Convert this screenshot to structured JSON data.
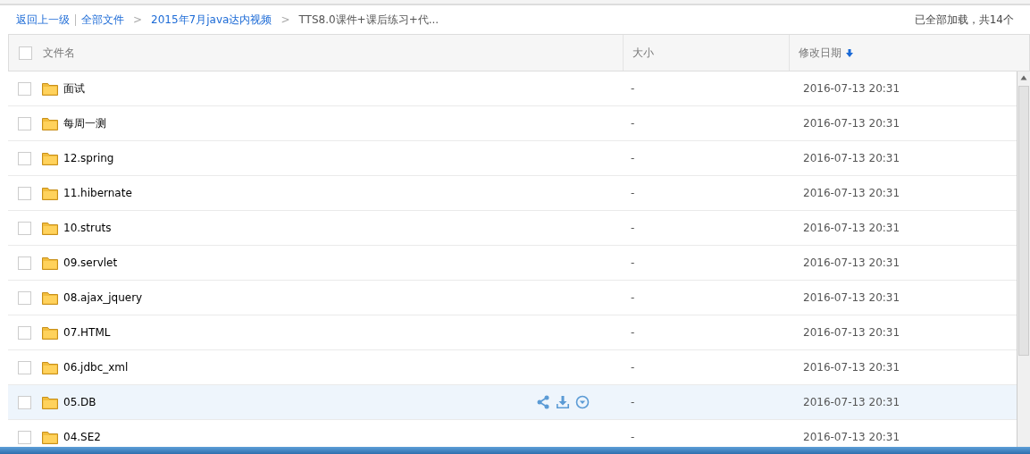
{
  "breadcrumb": {
    "back": "返回上一级",
    "items": [
      {
        "label": "全部文件",
        "link": true
      },
      {
        "label": "2015年7月java达内视频",
        "link": true,
        "separator": ">"
      },
      {
        "label": "TTS8.0课件+课后练习+代...",
        "link": false,
        "separator": ">"
      }
    ],
    "status": "已全部加载，共14个"
  },
  "table": {
    "select_all_checked": false,
    "columns": [
      {
        "label": "文件名"
      },
      {
        "label": "大小"
      },
      {
        "label": "修改日期",
        "sorted": true
      }
    ],
    "rows": [
      {
        "name": "面试",
        "size": "-",
        "date": "2016-07-13 20:31",
        "checked": false,
        "hovered": false
      },
      {
        "name": "每周一测",
        "size": "-",
        "date": "2016-07-13 20:31",
        "checked": false,
        "hovered": false
      },
      {
        "name": "12.spring",
        "size": "-",
        "date": "2016-07-13 20:31",
        "checked": false,
        "hovered": false
      },
      {
        "name": "11.hibernate",
        "size": "-",
        "date": "2016-07-13 20:31",
        "checked": false,
        "hovered": false
      },
      {
        "name": "10.struts",
        "size": "-",
        "date": "2016-07-13 20:31",
        "checked": false,
        "hovered": false
      },
      {
        "name": "09.servlet",
        "size": "-",
        "date": "2016-07-13 20:31",
        "checked": false,
        "hovered": false
      },
      {
        "name": "08.ajax_jquery",
        "size": "-",
        "date": "2016-07-13 20:31",
        "checked": false,
        "hovered": false
      },
      {
        "name": "07.HTML",
        "size": "-",
        "date": "2016-07-13 20:31",
        "checked": false,
        "hovered": false
      },
      {
        "name": "06.jdbc_xml",
        "size": "-",
        "date": "2016-07-13 20:31",
        "checked": false,
        "hovered": false
      },
      {
        "name": "05.DB",
        "size": "-",
        "date": "2016-07-13 20:31",
        "checked": false,
        "hovered": true
      },
      {
        "name": "04.SE2",
        "size": "-",
        "date": "2016-07-13 20:31",
        "checked": false,
        "hovered": false
      }
    ]
  }
}
